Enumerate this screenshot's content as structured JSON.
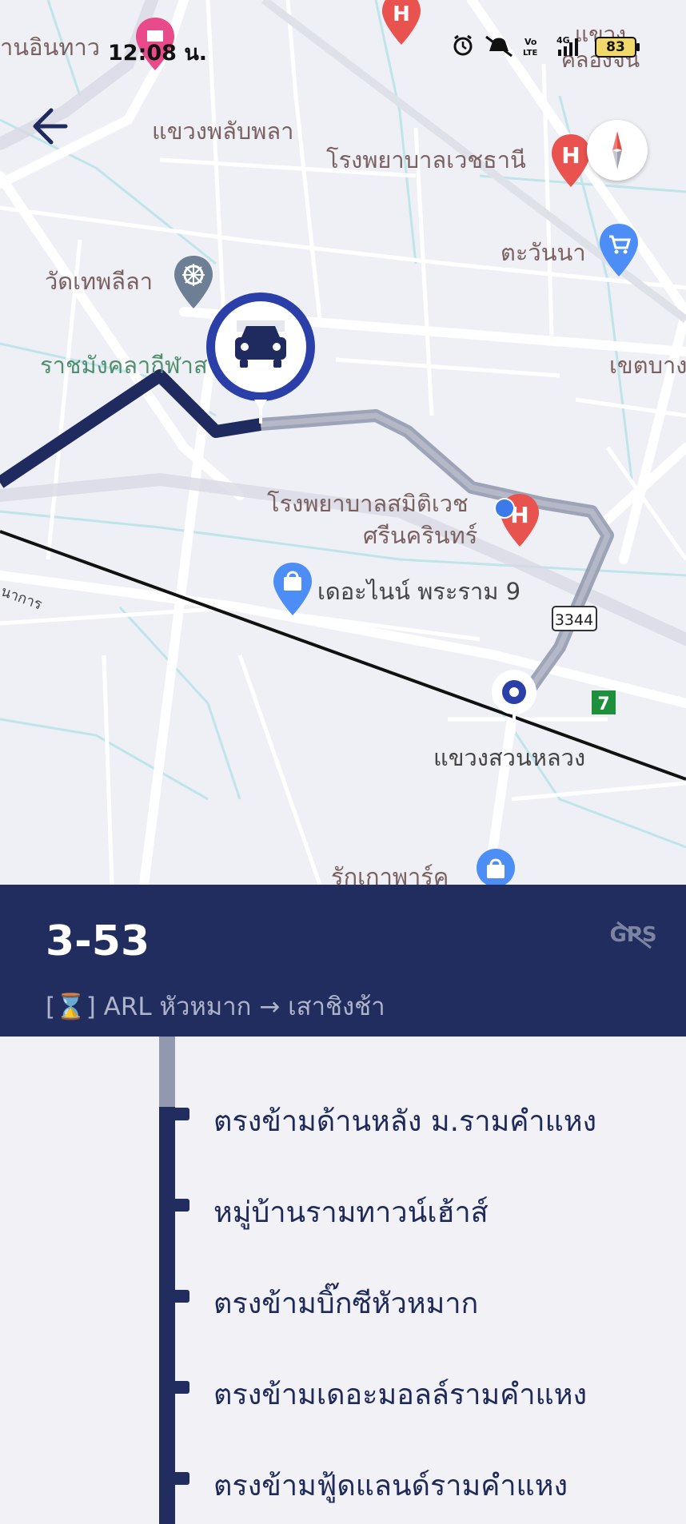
{
  "status_bar": {
    "time": "12:08 น.",
    "battery": "83",
    "icons": [
      "alarm-icon",
      "mute-icon",
      "volte-icon",
      "signal-4g-icon",
      "battery-icon"
    ]
  },
  "map": {
    "labels": {
      "top_left_partial": "านอินทาว",
      "top_right_partial": "แขวง คลองจั่น",
      "phlap_phla": "แขวงพลับพลา",
      "vejthani_hospital": "โรงพยาบาลเวชธานี",
      "tawanna": "ตะวันนา",
      "wat_thep_lila": "วัดเทพลีลา",
      "rajamangala": "ราชมังคลากีฬาส",
      "khet_bang": "เขตบางก",
      "samitivej_hospital_line1": "โรงพยาบาลสมิติเวช",
      "samitivej_hospital_line2": "ศรีนครินทร์",
      "the_nine": "เดอะไนน์ พระราม 9",
      "road_number": "3344",
      "suan_luang": "แขวงสวนหลวง",
      "rak_kao_park": "รักเกาพาร์ค",
      "road_partial": "นาการ"
    },
    "accent_color": "#2b3fa8"
  },
  "route": {
    "number": "3-53",
    "description": "[⌛] ARL หัวหมาก → เสาชิงช้า",
    "gps_label": "GPS"
  },
  "stops": [
    {
      "name": "ตรงข้ามด้านหลัง ม.รามคำแหง"
    },
    {
      "name": "หมู่บ้านรามทาวน์เฮ้าส์"
    },
    {
      "name": "ตรงข้ามบิ๊กซีหัวหมาก"
    },
    {
      "name": "ตรงข้ามเดอะมอลล์รามคำแหง"
    },
    {
      "name": "ตรงข้ามฟู้ดแลนด์รามคำแหง"
    }
  ]
}
